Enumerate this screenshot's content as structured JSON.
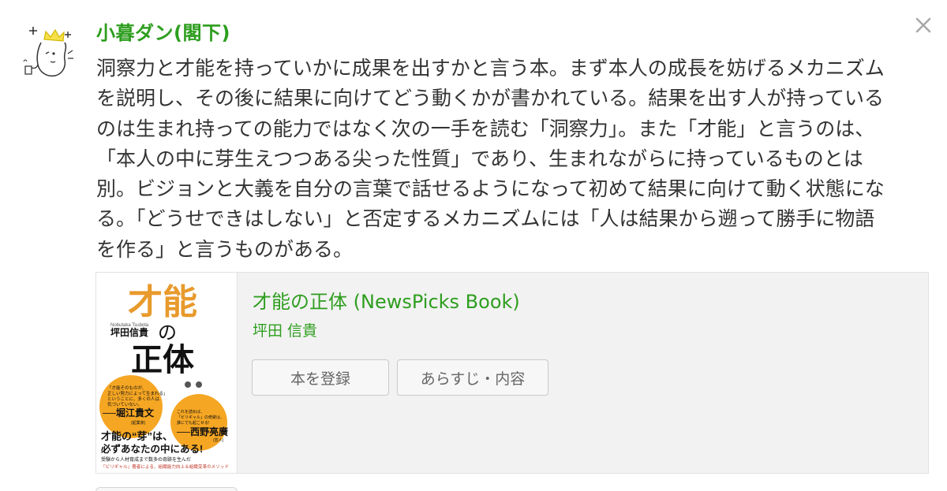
{
  "user": {
    "name": "小暮ダン(閣下)",
    "avatar_icon": "crowned-face-doodle-icon"
  },
  "close_icon": "close-icon",
  "review": {
    "lines": [
      "洞察力と才能を持っていかに成果を出すかと言う本。まず本人の成長を妨げるメカニズム",
      "を説明し、その後に結果に向けてどう動くかが書かれている。結果を出す人が持っている",
      "のは生まれ持っての能力ではなく次の一手を読む「洞察力」。また「才能」と言うのは、",
      "「本人の中に芽生えつつある尖った性質」であり、生まれながらに持っているものとは",
      "別。ビジョンと大義を自分の言葉で話せるようになって初めて結果に向けて動く状態にな",
      "る。「どうせできはしない」と否定するメカニズムには「人は結果から遡って勝手に物語",
      "を作る」と言うものがある。"
    ]
  },
  "book": {
    "title": "才能の正体 (NewsPicks Book)",
    "author": "坪田 信貴",
    "register_label": "本を登録",
    "synopsis_label": "あらすじ・内容",
    "cover": {
      "title_part1": "才能",
      "title_no": "の",
      "title_part2": "正体",
      "author_romaji": "Nobutaka Tsubota",
      "author": "坪田信貴",
      "blurb1_lines": [
        "「才能そのものが、",
        "正しい努力によって生まれる」",
        "ということに、多くの人は",
        "気づいていない。"
      ],
      "endorser1": "──堀江貴文",
      "endorser1_role": "(起業家)",
      "blurb2_lines": [
        "これを読めば、",
        "「ビリギャル」の奇跡は、",
        "誰にでも起こせる!"
      ],
      "endorser2": "──西野亮廣",
      "endorser2_role": "(芸人)",
      "tagline1": "才能の“芽”は、",
      "tagline2": "必ずあなたの中にある!",
      "sub1": "受験から人材育成まで数多の奇跡を生んだ",
      "sub2": "「ビリギャル」著者による、組織能力向上＆組織変革のメソッド",
      "colors": {
        "orange": "#f5a623",
        "gold": "#e89a2c",
        "black": "#111111"
      }
    }
  },
  "colors": {
    "accent_green": "#2e9e1f",
    "text": "#333333",
    "box_bg": "#f2f2f2"
  }
}
